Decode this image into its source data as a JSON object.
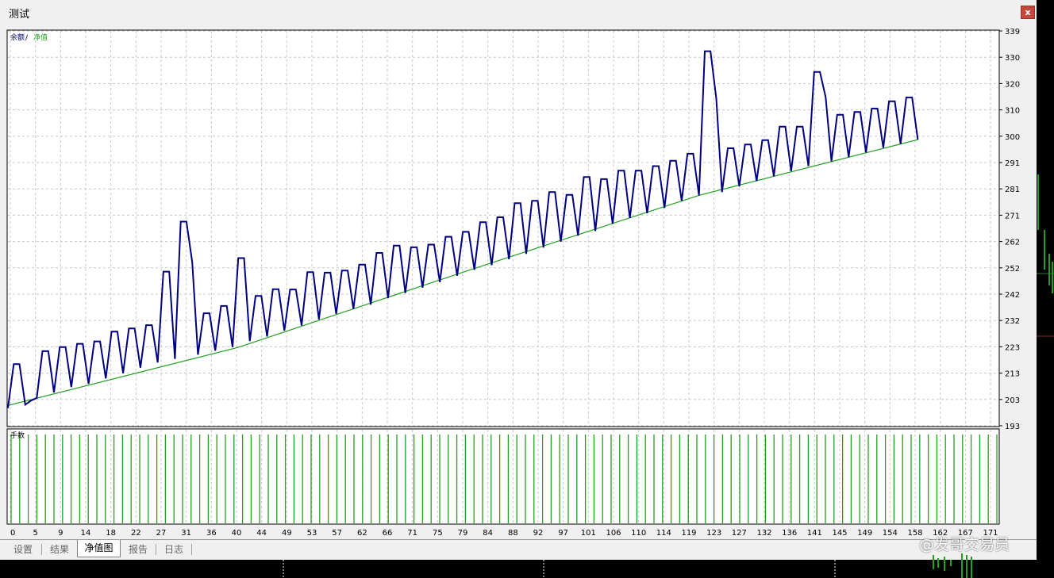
{
  "window": {
    "title": "测试",
    "close_label": "x"
  },
  "equity_panel": {
    "legend_balance": "余额",
    "legend_sep": " / ",
    "legend_equity": "净值"
  },
  "volume_panel": {
    "label": "手数"
  },
  "tabs": [
    {
      "label": "设置",
      "active": false
    },
    {
      "label": "结果",
      "active": false
    },
    {
      "label": "净值图",
      "active": true
    },
    {
      "label": "报告",
      "active": false
    },
    {
      "label": "日志",
      "active": false
    }
  ],
  "watermark": "@发哥交易员",
  "colors": {
    "balance_line": "#000080",
    "equity_line": "#22a022",
    "volume_bars": "#22a022",
    "grid": "#c8c8c8"
  },
  "chart_data": [
    {
      "type": "line",
      "title": "",
      "legend": [
        "余额",
        "净值"
      ],
      "y_ticks": [
        "193",
        "203",
        "213",
        "223",
        "232",
        "242",
        "252",
        "262",
        "271",
        "281",
        "291",
        "300",
        "310",
        "320",
        "330",
        "339"
      ],
      "x_ticks": [
        "0",
        "5",
        "9",
        "14",
        "18",
        "22",
        "27",
        "31",
        "36",
        "40",
        "44",
        "49",
        "53",
        "57",
        "62",
        "66",
        "71",
        "75",
        "79",
        "84",
        "88",
        "92",
        "97",
        "101",
        "106",
        "110",
        "114",
        "119",
        "123",
        "127",
        "132",
        "136",
        "141",
        "145",
        "149",
        "154",
        "158",
        "162",
        "167",
        "171"
      ],
      "ylim": [
        193,
        339
      ],
      "xlim": [
        0,
        172
      ],
      "series": [
        {
          "name": "余额",
          "points": [
            [
              0,
              199.5
            ],
            [
              1,
              215.8
            ],
            [
              2,
              215.8
            ],
            [
              3,
              200.8
            ],
            [
              4,
              202.3
            ],
            [
              5,
              203.3
            ],
            [
              6,
              220.6
            ],
            [
              7,
              220.6
            ],
            [
              8,
              205.3
            ],
            [
              9,
              222.1
            ],
            [
              10,
              222.1
            ],
            [
              11,
              207.3
            ],
            [
              12,
              223.3
            ],
            [
              13,
              223.3
            ],
            [
              14,
              208.5
            ],
            [
              15,
              224.2
            ],
            [
              16,
              224.2
            ],
            [
              17,
              210.5
            ],
            [
              18,
              227.8
            ],
            [
              19,
              227.8
            ],
            [
              20,
              212.4
            ],
            [
              21,
              229.0
            ],
            [
              22,
              229.0
            ],
            [
              23,
              214.5
            ],
            [
              24,
              230.2
            ],
            [
              25,
              230.2
            ],
            [
              26,
              216.4
            ],
            [
              27,
              250.0
            ],
            [
              28,
              250.0
            ],
            [
              29,
              217.7
            ],
            [
              30,
              268.5
            ],
            [
              31,
              268.5
            ],
            [
              32,
              253.5
            ],
            [
              33,
              219.3
            ],
            [
              34,
              234.6
            ],
            [
              35,
              234.6
            ],
            [
              36,
              220.8
            ],
            [
              37,
              237.3
            ],
            [
              38,
              237.3
            ],
            [
              39,
              222.1
            ],
            [
              40,
              255.0
            ],
            [
              41,
              255.0
            ],
            [
              42,
              224.3
            ],
            [
              43,
              241.0
            ],
            [
              44,
              241.0
            ],
            [
              45,
              226.0
            ],
            [
              46,
              243.5
            ],
            [
              47,
              243.5
            ],
            [
              48,
              228.2
            ],
            [
              49,
              243.4
            ],
            [
              50,
              243.4
            ],
            [
              51,
              230.1
            ],
            [
              52,
              249.8
            ],
            [
              53,
              249.8
            ],
            [
              54,
              232.3
            ],
            [
              55,
              249.6
            ],
            [
              56,
              249.6
            ],
            [
              57,
              234.4
            ],
            [
              58,
              250.4
            ],
            [
              59,
              250.4
            ],
            [
              60,
              236.2
            ],
            [
              61,
              252.6
            ],
            [
              62,
              252.6
            ],
            [
              63,
              237.8
            ],
            [
              64,
              256.9
            ],
            [
              65,
              256.9
            ],
            [
              66,
              240.2
            ],
            [
              67,
              259.6
            ],
            [
              68,
              259.6
            ],
            [
              69,
              242.1
            ],
            [
              70,
              259.0
            ],
            [
              71,
              259.0
            ],
            [
              72,
              244.1
            ],
            [
              73,
              260.0
            ],
            [
              74,
              260.0
            ],
            [
              75,
              246.1
            ],
            [
              76,
              262.9
            ],
            [
              77,
              262.9
            ],
            [
              78,
              248.5
            ],
            [
              79,
              264.7
            ],
            [
              80,
              264.7
            ],
            [
              81,
              250.7
            ],
            [
              82,
              268.3
            ],
            [
              83,
              268.3
            ],
            [
              84,
              252.4
            ],
            [
              85,
              270.1
            ],
            [
              86,
              270.1
            ],
            [
              87,
              254.6
            ],
            [
              88,
              275.3
            ],
            [
              89,
              275.3
            ],
            [
              90,
              256.6
            ],
            [
              91,
              276.2
            ],
            [
              92,
              276.2
            ],
            [
              93,
              258.9
            ],
            [
              94,
              279.4
            ],
            [
              95,
              279.4
            ],
            [
              96,
              261.1
            ],
            [
              97,
              278.4
            ],
            [
              98,
              278.4
            ],
            [
              99,
              263.3
            ],
            [
              100,
              285.0
            ],
            [
              101,
              285.0
            ],
            [
              102,
              265.0
            ],
            [
              103,
              284.2
            ],
            [
              104,
              284.2
            ],
            [
              105,
              267.7
            ],
            [
              106,
              287.3
            ],
            [
              107,
              287.3
            ],
            [
              108,
              269.8
            ],
            [
              109,
              287.3
            ],
            [
              110,
              287.3
            ],
            [
              111,
              271.6
            ],
            [
              112,
              289.0
            ],
            [
              113,
              289.0
            ],
            [
              114,
              273.6
            ],
            [
              115,
              291.0
            ],
            [
              116,
              291.0
            ],
            [
              117,
              276.1
            ],
            [
              118,
              293.6
            ],
            [
              119,
              293.6
            ],
            [
              120,
              278.2
            ],
            [
              121,
              331.5
            ],
            [
              122,
              331.5
            ],
            [
              123,
              314.0
            ],
            [
              124,
              279.4
            ],
            [
              125,
              295.6
            ],
            [
              126,
              295.6
            ],
            [
              127,
              281.5
            ],
            [
              128,
              297.0
            ],
            [
              129,
              297.0
            ],
            [
              130,
              283.5
            ],
            [
              131,
              298.6
            ],
            [
              132,
              298.6
            ],
            [
              133,
              285.3
            ],
            [
              134,
              303.6
            ],
            [
              135,
              303.6
            ],
            [
              136,
              287.2
            ],
            [
              137,
              303.6
            ],
            [
              138,
              303.6
            ],
            [
              139,
              289.0
            ],
            [
              140,
              323.8
            ],
            [
              141,
              323.8
            ],
            [
              142,
              314.5
            ],
            [
              143,
              290.8
            ],
            [
              144,
              308.0
            ],
            [
              145,
              308.0
            ],
            [
              146,
              292.4
            ],
            [
              147,
              309.0
            ],
            [
              148,
              309.0
            ],
            [
              149,
              294.1
            ],
            [
              150,
              310.3
            ],
            [
              151,
              310.3
            ],
            [
              152,
              295.8
            ],
            [
              153,
              313.0
            ],
            [
              154,
              313.0
            ],
            [
              155,
              297.2
            ],
            [
              156,
              314.4
            ],
            [
              157,
              314.4
            ],
            [
              158,
              298.8
            ]
          ]
        },
        {
          "name": "净值",
          "points": [
            [
              0,
              200.5
            ],
            [
              40,
              222.0
            ],
            [
              80,
              250.5
            ],
            [
              120,
              278.2
            ],
            [
              158,
              298.8
            ]
          ]
        }
      ]
    },
    {
      "type": "bar",
      "title": "手数",
      "bar_count": 116
    }
  ]
}
